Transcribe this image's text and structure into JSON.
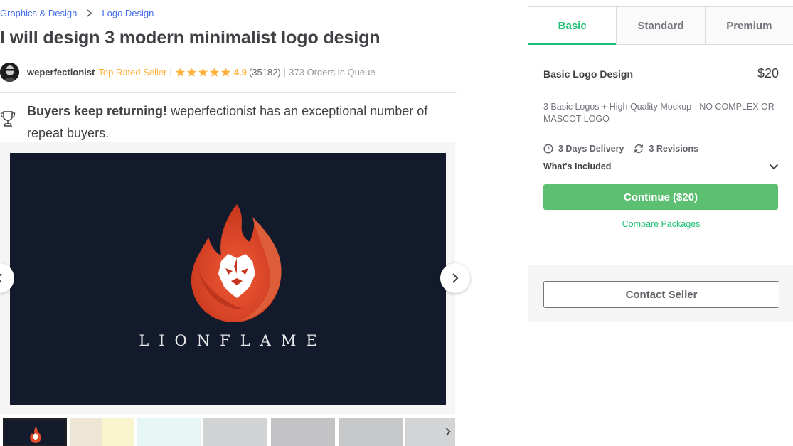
{
  "breadcrumb": {
    "category": "Graphics & Design",
    "subcategory": "Logo Design"
  },
  "gig": {
    "title": "I will design 3 modern minimalist logo design"
  },
  "seller": {
    "name": "weperfectionist",
    "level": "Top Rated Seller",
    "rating": "4.9",
    "reviews": "(35182)",
    "queue": "373 Orders in Queue",
    "stars": 5
  },
  "notice": {
    "bold": "Buyers keep returning!",
    "text": " weperfectionist has an exceptional number of repeat buyers."
  },
  "gallery": {
    "brand_text": "LIONFLAME"
  },
  "package": {
    "tabs": [
      "Basic",
      "Standard",
      "Premium"
    ],
    "active_tab": "Basic",
    "name": "Basic Logo Design",
    "price": "$20",
    "description": "3 Basic Logos + High Quality Mockup - NO COMPLEX OR MASCOT LOGO",
    "delivery": "3 Days Delivery",
    "revisions": "3 Revisions",
    "included_label": "What's Included",
    "continue_label": "Continue ($20)",
    "compare_label": "Compare Packages"
  },
  "contact": {
    "label": "Contact Seller"
  },
  "colors": {
    "accent_green": "#1dbf73",
    "button_green": "#5cbf72",
    "link_blue": "#446ee7",
    "star_yellow": "#ffb33e",
    "image_bg": "#121a2c"
  }
}
